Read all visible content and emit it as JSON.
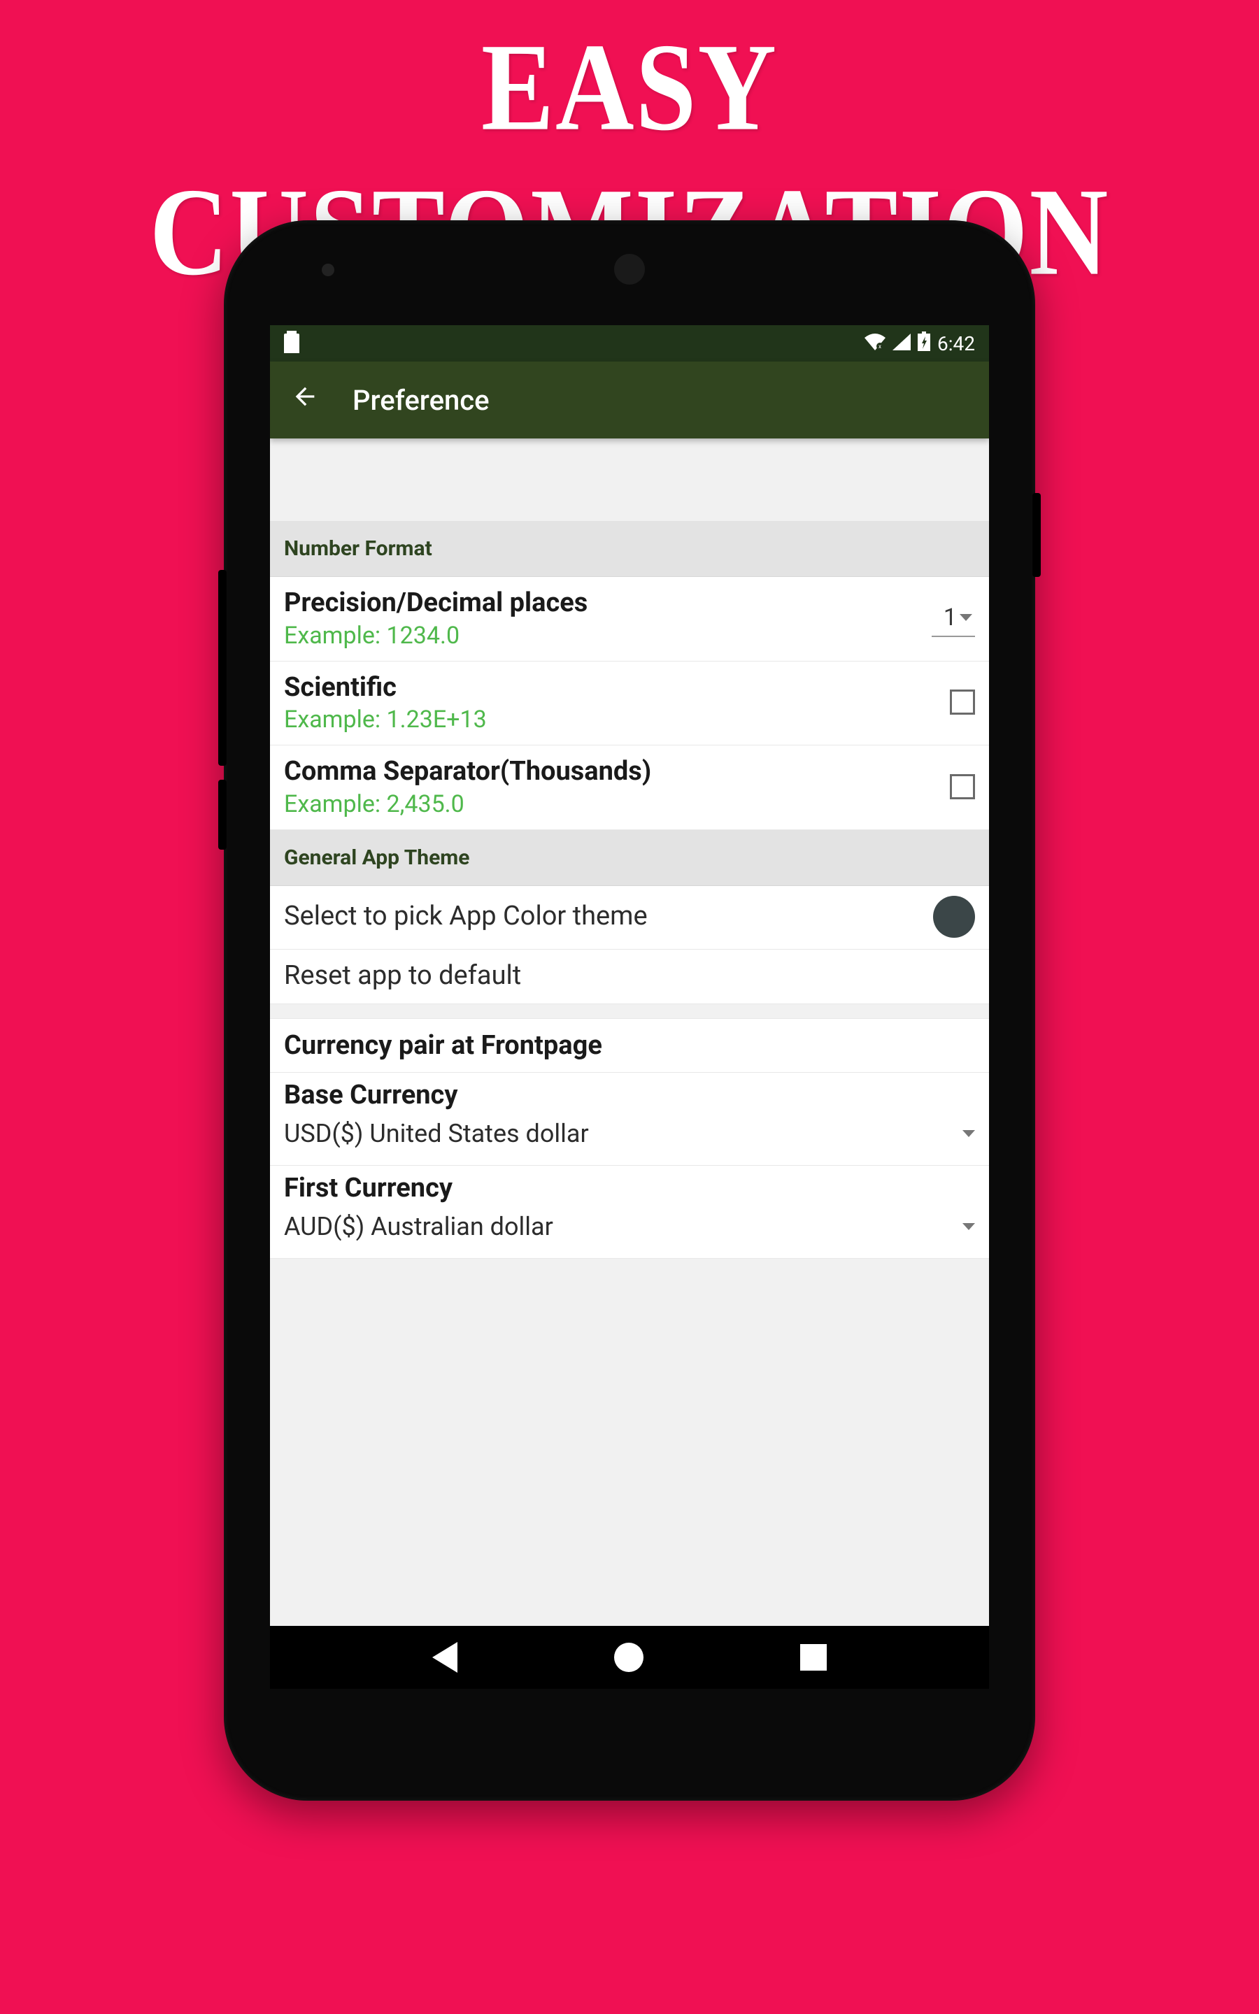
{
  "promo": {
    "title": "EASY CUSTOMIZATION"
  },
  "status": {
    "time": "6:42"
  },
  "appbar": {
    "title": "Preference"
  },
  "sections": {
    "number_format": {
      "header": "Number Format",
      "precision": {
        "title": "Precision/Decimal places",
        "sub": "Example: 1234.0",
        "value": "1"
      },
      "scientific": {
        "title": "Scientific",
        "sub": "Example: 1.23E+13"
      },
      "comma": {
        "title": "Comma Separator(Thousands)",
        "sub": "Example: 2,435.0"
      }
    },
    "theme": {
      "header": "General App Theme",
      "pick": "Select to pick App Color theme",
      "reset": "Reset app to default",
      "color": "#3b4648"
    },
    "currency": {
      "pair_title": "Currency pair at Frontpage",
      "base_label": "Base Currency",
      "base_value": "USD($) United States dollar",
      "first_label": "First Currency",
      "first_value": "AUD($) Australian dollar"
    }
  }
}
